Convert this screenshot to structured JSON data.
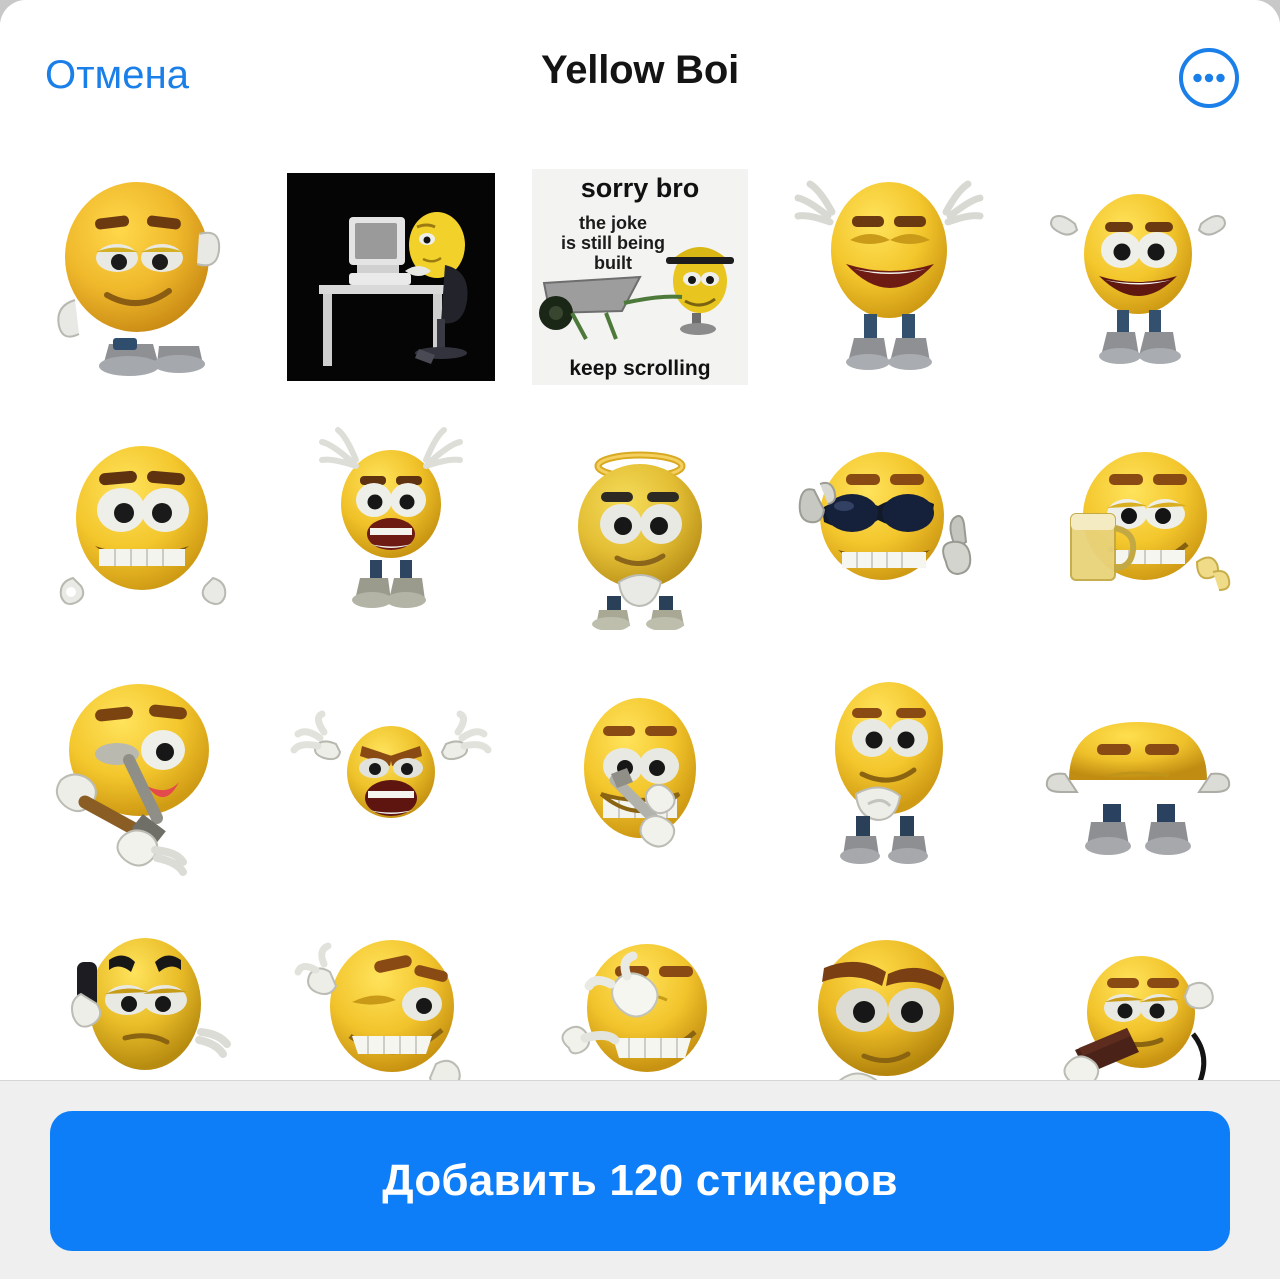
{
  "window": {
    "background_color": "#ffffff",
    "accent_color": "#0d7ef7"
  },
  "header": {
    "cancel_label": "Отмена",
    "title": "Yellow Boi",
    "more_icon": "more-circle-icon",
    "cancel_color": "#1a7fe8",
    "title_color": "#141414"
  },
  "footer": {
    "add_button_label": "Добавить 120 стикеров",
    "add_button_color": "#0d7ef7",
    "background_color": "#f0efef"
  },
  "meme_sticker": {
    "top_text": "sorry bro",
    "middle_text": "the joke\nis still being\nbuilt",
    "middle_line1": "the joke",
    "middle_line2": "is still being",
    "middle_line3": "built",
    "bottom_text": "keep scrolling"
  },
  "grid": {
    "columns": 5,
    "sticker_count_visible": 20,
    "stickers": [
      {
        "id": 1,
        "name": "smug-tired-emoji",
        "alt": "Yellow emoji with heavy eyelids, smug smile, waving hand, grey shoes"
      },
      {
        "id": 2,
        "name": "emoji-at-computer",
        "alt": "Dark scene: yellow emoji sitting at a desk typing on a computer"
      },
      {
        "id": 3,
        "name": "sorry-bro-meme",
        "alt": "Meme image: sorry bro, the joke is still being built, keep scrolling"
      },
      {
        "id": 4,
        "name": "laughing-arms-up-emoji",
        "alt": "Yellow emoji laughing with both arms raised, eyes closed"
      },
      {
        "id": 5,
        "name": "excited-arms-up-emoji",
        "alt": "Yellow emoji with big eyes smiling, arms raised"
      },
      {
        "id": 6,
        "name": "big-grin-emoji",
        "alt": "Yellow emoji with big googly eyes and toothy grin, hands at sides"
      },
      {
        "id": 7,
        "name": "surprised-hands-emoji",
        "alt": "Yellow emoji shocked, open mouth, hands up beside head, boots below"
      },
      {
        "id": 8,
        "name": "angel-halo-emoji",
        "alt": "Innocent yellow emoji with golden halo, hands folded"
      },
      {
        "id": 9,
        "name": "sunglasses-thumbsup-emoji",
        "alt": "Cool yellow emoji lowering black sunglasses with thumbs up"
      },
      {
        "id": 10,
        "name": "beer-mug-emoji",
        "alt": "Yellow emoji holding a mug of beer, grinning, ok hand"
      },
      {
        "id": 11,
        "name": "hammer-tongue-emoji",
        "alt": "Yellow emoji holding hammer, tongue out, one eye squinting"
      },
      {
        "id": 12,
        "name": "angry-jazz-hands-emoji",
        "alt": "Small angry yellow emoji shouting with both hands spread"
      },
      {
        "id": 13,
        "name": "knife-teeth-emoji",
        "alt": "Yellow emoji holding a knife between its teeth"
      },
      {
        "id": 14,
        "name": "shy-standing-emoji",
        "alt": "Yellow emoji standing, hands clasped, shy smile, grey boots"
      },
      {
        "id": 15,
        "name": "peeking-emoji",
        "alt": "Yellow emoji peeking over the edge, only top of head and hands visible"
      },
      {
        "id": 16,
        "name": "phone-call-emoji",
        "alt": "Yellow emoji holding a phone to its ear, annoyed expression"
      },
      {
        "id": 17,
        "name": "embarrassed-grin-emoji",
        "alt": "Yellow emoji scratching head with embarrassed toothy grin"
      },
      {
        "id": 18,
        "name": "pointing-laughing-emoji",
        "alt": "Yellow emoji pointing and laughing, hand over mouth"
      },
      {
        "id": 19,
        "name": "thinking-big-eyes-emoji",
        "alt": "Yellow emoji with thick eyebrows and big eyes, hands below chin"
      },
      {
        "id": 20,
        "name": "chocolate-bar-emoji",
        "alt": "Yellow emoji holding a bar of chocolate"
      }
    ]
  }
}
